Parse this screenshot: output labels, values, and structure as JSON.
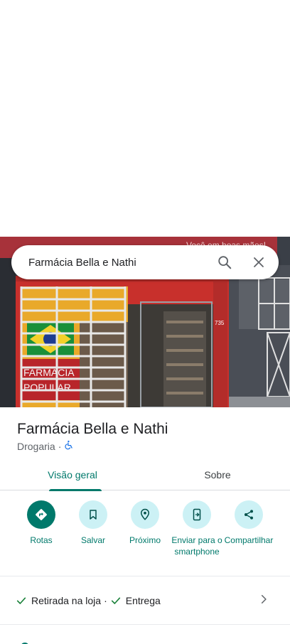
{
  "search": {
    "query": "Farmácia Bella e Nathi"
  },
  "place": {
    "name": "Farmácia Bella e Nathi",
    "category": "Drogaria",
    "separator": "·"
  },
  "photo": {
    "sign_text": "Você em boas mãos!",
    "number": "735",
    "poster_line1": "FARMÁCIA",
    "poster_line2": "POPULAR"
  },
  "tabs": [
    {
      "label": "Visão geral",
      "active": true
    },
    {
      "label": "Sobre",
      "active": false
    }
  ],
  "actions": [
    {
      "label": "Rotas",
      "icon": "directions-icon"
    },
    {
      "label": "Salvar",
      "icon": "bookmark-icon"
    },
    {
      "label": "Próximo",
      "icon": "nearby-icon"
    },
    {
      "label": "Enviar para o smartphone",
      "icon": "send-to-phone-icon"
    },
    {
      "label": "Compartilhar",
      "icon": "share-icon"
    }
  ],
  "services": [
    {
      "label": "Retirada na loja"
    },
    {
      "label": "Entrega"
    }
  ],
  "services_separator": "·",
  "colors": {
    "accent": "#00796b",
    "action_bg": "#ccf1f5",
    "check": "#188038"
  }
}
